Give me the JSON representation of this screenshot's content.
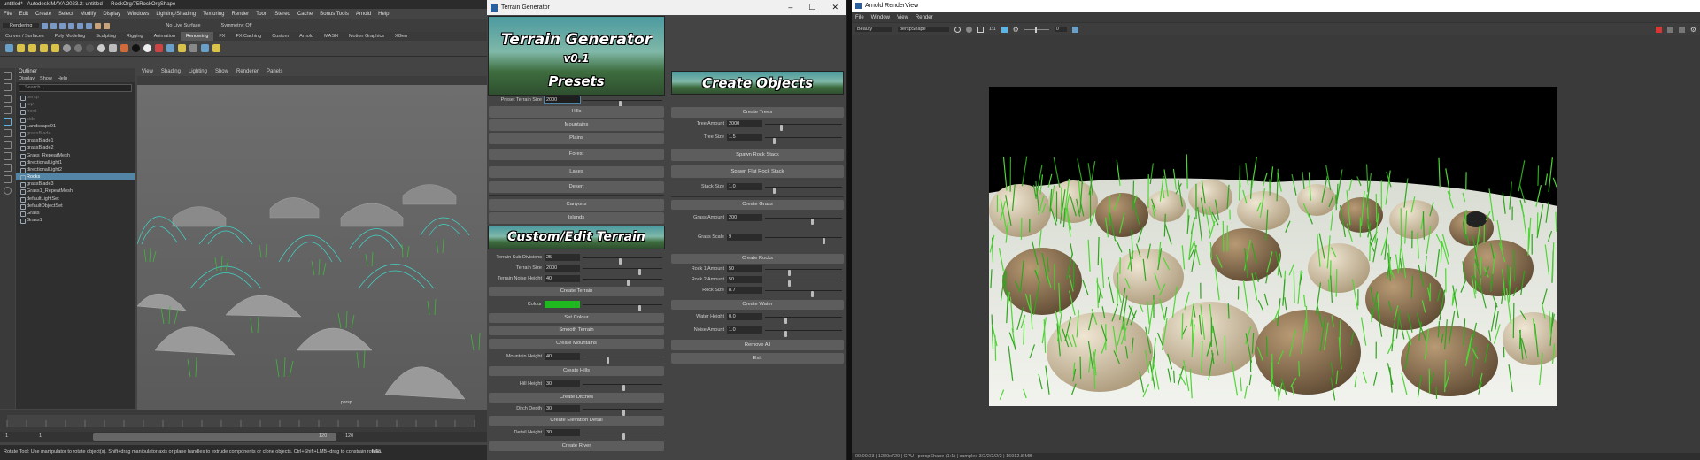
{
  "maya": {
    "title": "untitled* - Autodesk MAYA 2023.2: untitled  ---  RockOrg/75RockOrgShape",
    "menu": [
      "File",
      "Edit",
      "Create",
      "Select",
      "Modify",
      "Display",
      "Windows",
      "Lighting/Shading",
      "Texturing",
      "Render",
      "Toon",
      "Stereo",
      "Cache",
      "Bonus Tools",
      "Arnold",
      "Help"
    ],
    "mode": "Rendering",
    "live_surface": "No Live Surface",
    "symmetry": "Symmetry: Off",
    "shelf_tabs": [
      "Curves / Surfaces",
      "Poly Modeling",
      "Sculpting",
      "Rigging",
      "Animation",
      "Rendering",
      "FX",
      "FX Caching",
      "Custom",
      "Arnold",
      "MASH",
      "Motion Graphics",
      "XGen"
    ],
    "active_shelf": "Rendering",
    "outliner": {
      "title": "Outliner",
      "menu": [
        "Display",
        "Show",
        "Help"
      ],
      "search_placeholder": "Search...",
      "items": [
        {
          "label": "persp",
          "dim": true
        },
        {
          "label": "top",
          "dim": true
        },
        {
          "label": "front",
          "dim": true
        },
        {
          "label": "side",
          "dim": true
        },
        {
          "label": "Landscape01",
          "dim": false
        },
        {
          "label": "grassBlade",
          "dim": true
        },
        {
          "label": "grassBlade1",
          "dim": false
        },
        {
          "label": "grassBlade2",
          "dim": false
        },
        {
          "label": "Grass_RepeatMesh",
          "dim": false
        },
        {
          "label": "directionalLight1",
          "dim": false
        },
        {
          "label": "directionalLight2",
          "dim": false
        },
        {
          "label": "Rocks",
          "dim": false,
          "selected": true
        },
        {
          "label": "grassBlade3",
          "dim": false
        },
        {
          "label": "Grass1_RepeatMesh",
          "dim": false
        },
        {
          "label": "defaultLightSet",
          "dim": false
        },
        {
          "label": "defaultObjectSet",
          "dim": false
        },
        {
          "label": "Grass",
          "dim": false
        },
        {
          "label": "Grass1",
          "dim": false
        }
      ]
    },
    "viewport_menu": [
      "View",
      "Shading",
      "Lighting",
      "Show",
      "Renderer",
      "Panels"
    ],
    "camera_label": "persp",
    "timeline": {
      "start": "1",
      "end": "120",
      "range_start": "1",
      "range_end": "120"
    },
    "help_line": "Rotate Tool: Use manipulator to rotate object(s). Shift+drag manipulator axis or plane handles to extrude components or clone objects. Ctrl+Shift+LMB+drag to constrain rotatio",
    "mel": "MEL"
  },
  "tg": {
    "title": "Terrain Generator",
    "banner_title": "Terrain Generator",
    "version": "v0.1",
    "presets_title": "Presets",
    "create_objects_title": "Create Objects",
    "custom_title": "Custom/Edit Terrain",
    "preset_size_label": "Preset Terrain Size",
    "preset_size_value": "2000",
    "presets": [
      "Hills",
      "Mountains",
      "Plains",
      "Forest",
      "Lakes",
      "Desert",
      "Canyons",
      "Islands"
    ],
    "custom": {
      "sub_div_label": "Terrain Sub Divisions",
      "sub_div": "25",
      "size_label": "Terrain Size",
      "size": "2000",
      "noise_label": "Terrain Noise Height",
      "noise": "40",
      "create_terrain": "Create Terrain",
      "colour_label": "Colour",
      "set_colour": "Set Colour",
      "smooth": "Smooth Terrain",
      "create_mountains": "Create Mountains",
      "mountain_label": "Mountain Height",
      "mountain": "40",
      "create_hills": "Create Hills",
      "hill_label": "Hill Height",
      "hill": "30",
      "create_ditches": "Create Ditches",
      "ditch_label": "Ditch Depth",
      "ditch": "30",
      "create_elev": "Create Elevation Detail",
      "detail_label": "Detail Height",
      "detail": "30",
      "create_river": "Create River"
    },
    "objects": {
      "create_trees": "Create Trees",
      "tree_amount_label": "Tree Amount",
      "tree_amount": "2000",
      "tree_size_label": "Tree Size",
      "tree_size": "1.5",
      "spawn_rock_stack": "Spawn Rock Stack",
      "spawn_flat_rock_stack": "Spawn Flat Rock Stack",
      "stack_size_label": "Stack Size",
      "stack_size": "1.0",
      "create_grass": "Create Grass",
      "grass_amount_label": "Grass Amount",
      "grass_amount": "200",
      "grass_scale_label": "Grass Scale",
      "grass_scale": "9",
      "create_rocks": "Create Rocks",
      "rock1_label": "Rock 1 Amount",
      "rock1": "50",
      "rock2_label": "Rock 2 Amount",
      "rock2": "50",
      "rock_size_label": "Rock Size",
      "rock_size": "8.7",
      "create_water": "Create Water",
      "water_height_label": "Water Height",
      "water_height": "0.0",
      "noise_amount_label": "Noise Amount",
      "noise_amount": "1.0",
      "remove_all": "Remove All",
      "exit": "Exit"
    },
    "colour": "#1fb81f"
  },
  "arv": {
    "title": "Arnold RenderView",
    "menu": [
      "File",
      "Window",
      "View",
      "Render"
    ],
    "aov": "Beauty",
    "camera": "perspShape",
    "zoom": "1:1",
    "exposure": "0",
    "status": "00:00:03 | 1280x720 | CPU | perspShape (1:1) | samples 3/2/2/2/2/2 | 16912.8 MB"
  }
}
